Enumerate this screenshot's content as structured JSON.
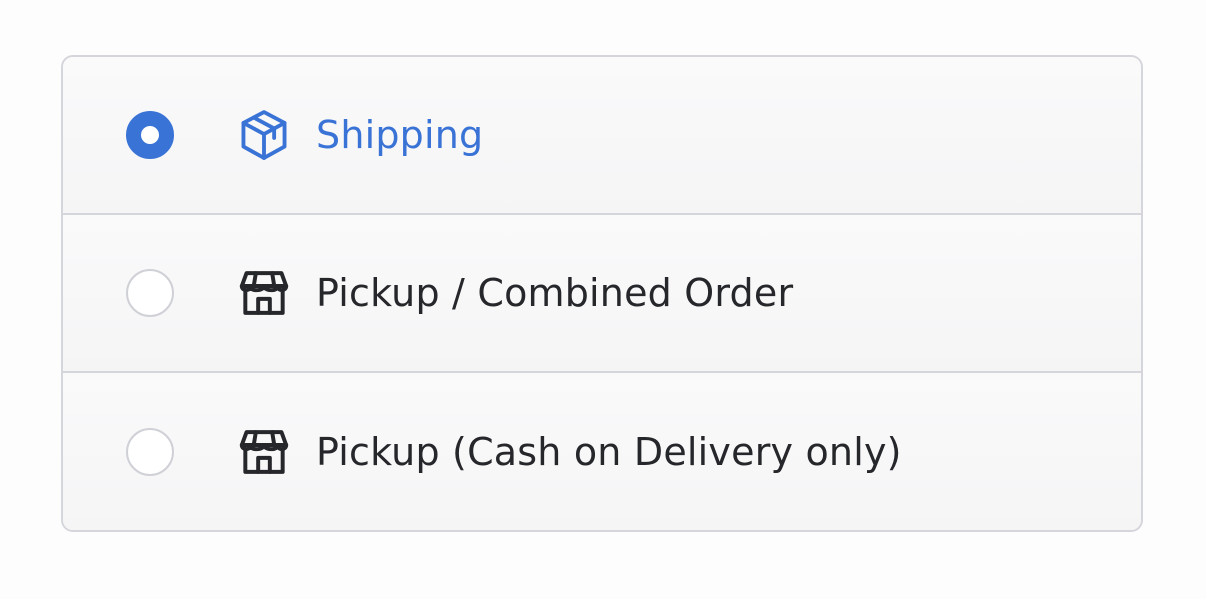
{
  "delivery_options": {
    "items": [
      {
        "label": "Shipping",
        "icon": "package-box-icon",
        "selected": true
      },
      {
        "label": "Pickup / Combined Order",
        "icon": "storefront-icon",
        "selected": false
      },
      {
        "label": "Pickup (Cash on Delivery only)",
        "icon": "storefront-icon",
        "selected": false
      }
    ]
  },
  "colors": {
    "accent": "#3a73d6",
    "text": "#26272b",
    "border": "#d4d6db",
    "background": "#f7f7f8"
  }
}
